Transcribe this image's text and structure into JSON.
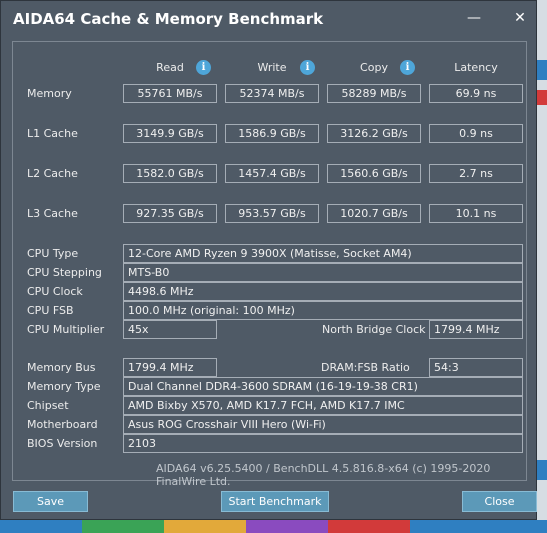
{
  "window": {
    "title": "AIDA64 Cache & Memory Benchmark"
  },
  "columns": {
    "read": "Read",
    "write": "Write",
    "copy": "Copy",
    "latency": "Latency"
  },
  "rows": [
    {
      "label": "Memory",
      "read": "55761 MB/s",
      "write": "52374 MB/s",
      "copy": "58289 MB/s",
      "latency": "69.9 ns"
    },
    {
      "label": "L1 Cache",
      "read": "3149.9 GB/s",
      "write": "1586.9 GB/s",
      "copy": "3126.2 GB/s",
      "latency": "0.9 ns"
    },
    {
      "label": "L2 Cache",
      "read": "1582.0 GB/s",
      "write": "1457.4 GB/s",
      "copy": "1560.6 GB/s",
      "latency": "2.7 ns"
    },
    {
      "label": "L3 Cache",
      "read": "927.35 GB/s",
      "write": "953.57 GB/s",
      "copy": "1020.7 GB/s",
      "latency": "10.1 ns"
    }
  ],
  "cpu": {
    "type_label": "CPU Type",
    "type": "12-Core AMD Ryzen 9 3900X  (Matisse, Socket AM4)",
    "stepping_label": "CPU Stepping",
    "stepping": "MTS-B0",
    "clock_label": "CPU Clock",
    "clock": "4498.6 MHz",
    "fsb_label": "CPU FSB",
    "fsb": "100.0 MHz  (original: 100 MHz)",
    "multiplier_label": "CPU Multiplier",
    "multiplier": "45x",
    "nb_label": "North Bridge Clock",
    "nb": "1799.4 MHz"
  },
  "memory": {
    "bus_label": "Memory Bus",
    "bus": "1799.4 MHz",
    "ratio_label": "DRAM:FSB Ratio",
    "ratio": "54:3",
    "type_label": "Memory Type",
    "type": "Dual Channel DDR4-3600 SDRAM  (16-19-19-38 CR1)",
    "chipset_label": "Chipset",
    "chipset": "AMD Bixby X570, AMD K17.7 FCH, AMD K17.7 IMC",
    "motherboard_label": "Motherboard",
    "motherboard": "Asus ROG Crosshair VIII Hero (Wi-Fi)",
    "bios_label": "BIOS Version",
    "bios": "2103"
  },
  "footer": "AIDA64 v6.25.5400 / BenchDLL 4.5.816.8-x64  (c) 1995-2020 FinalWire Ltd.",
  "buttons": {
    "save_label": "Save",
    "start_label": "Start Benchmark",
    "close_label": "Close"
  },
  "icons": {
    "info": "i",
    "minimize": "—",
    "close": "✕"
  }
}
